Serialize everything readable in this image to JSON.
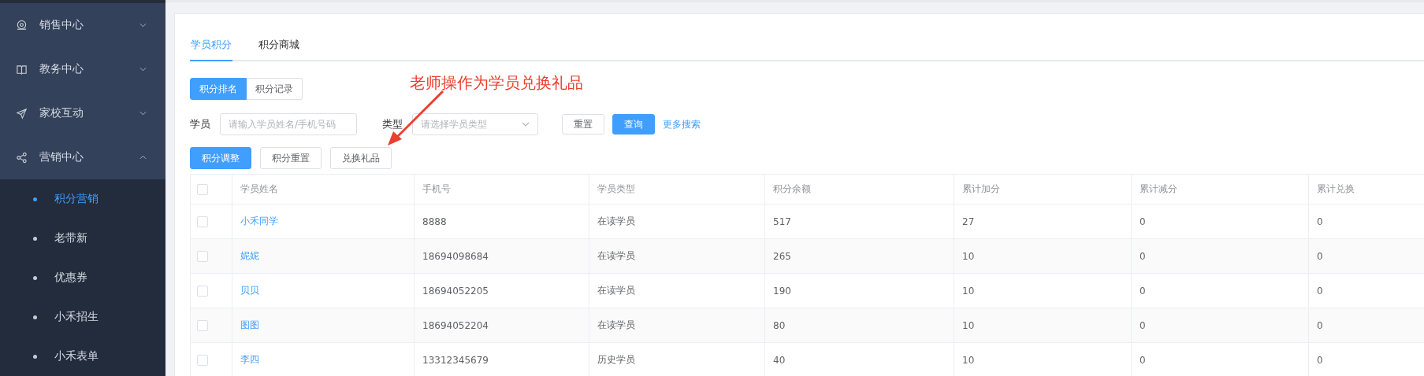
{
  "sidebar": {
    "menus": [
      {
        "label": "销售中心",
        "expanded": false
      },
      {
        "label": "教务中心",
        "expanded": false
      },
      {
        "label": "家校互动",
        "expanded": false
      },
      {
        "label": "营销中心",
        "expanded": true,
        "children": [
          {
            "label": "积分营销",
            "selected": true
          },
          {
            "label": "老带新",
            "selected": false
          },
          {
            "label": "优惠券",
            "selected": false
          },
          {
            "label": "小禾招生",
            "selected": false
          },
          {
            "label": "小禾表单",
            "selected": false
          }
        ]
      }
    ]
  },
  "tabs": [
    {
      "label": "学员积分",
      "selected": true
    },
    {
      "label": "积分商城",
      "selected": false
    }
  ],
  "segments": [
    {
      "label": "积分排名",
      "selected": true
    },
    {
      "label": "积分记录",
      "selected": false
    }
  ],
  "filters": [
    {
      "label": "学员",
      "kind": "input",
      "placeholder": "请输入学员姓名/手机号码"
    },
    {
      "label": "类型",
      "kind": "select",
      "placeholder": "请选择学员类型"
    }
  ],
  "filter_buttons": [
    {
      "label": "重置",
      "kind": "default"
    },
    {
      "label": "查询",
      "kind": "primary"
    },
    {
      "label": "更多搜索",
      "kind": "link"
    }
  ],
  "actions": [
    {
      "label": "积分调整",
      "kind": "primary"
    },
    {
      "label": "积分重置",
      "kind": "default"
    },
    {
      "label": "兑换礼品",
      "kind": "default"
    }
  ],
  "annotation": "老师操作为学员兑换礼品",
  "table": {
    "select_all": {
      "checked": false
    },
    "columns": [
      "学员姓名",
      "手机号",
      "学员类型",
      "积分余额",
      "累计加分",
      "累计减分",
      "累计兑换"
    ],
    "rows": [
      {
        "checked": false,
        "cells": [
          "小禾同学",
          "8888",
          "在读学员",
          "517",
          "27",
          "0",
          "0"
        ]
      },
      {
        "checked": false,
        "cells": [
          "妮妮",
          "18694098684",
          "在读学员",
          "265",
          "10",
          "0",
          "0"
        ]
      },
      {
        "checked": false,
        "cells": [
          "贝贝",
          "18694052205",
          "在读学员",
          "190",
          "10",
          "0",
          "0"
        ]
      },
      {
        "checked": false,
        "cells": [
          "图图",
          "18694052204",
          "在读学员",
          "80",
          "10",
          "0",
          "0"
        ]
      },
      {
        "checked": false,
        "cells": [
          "李四",
          "13312345679",
          "历史学员",
          "40",
          "10",
          "0",
          "0"
        ]
      }
    ]
  }
}
